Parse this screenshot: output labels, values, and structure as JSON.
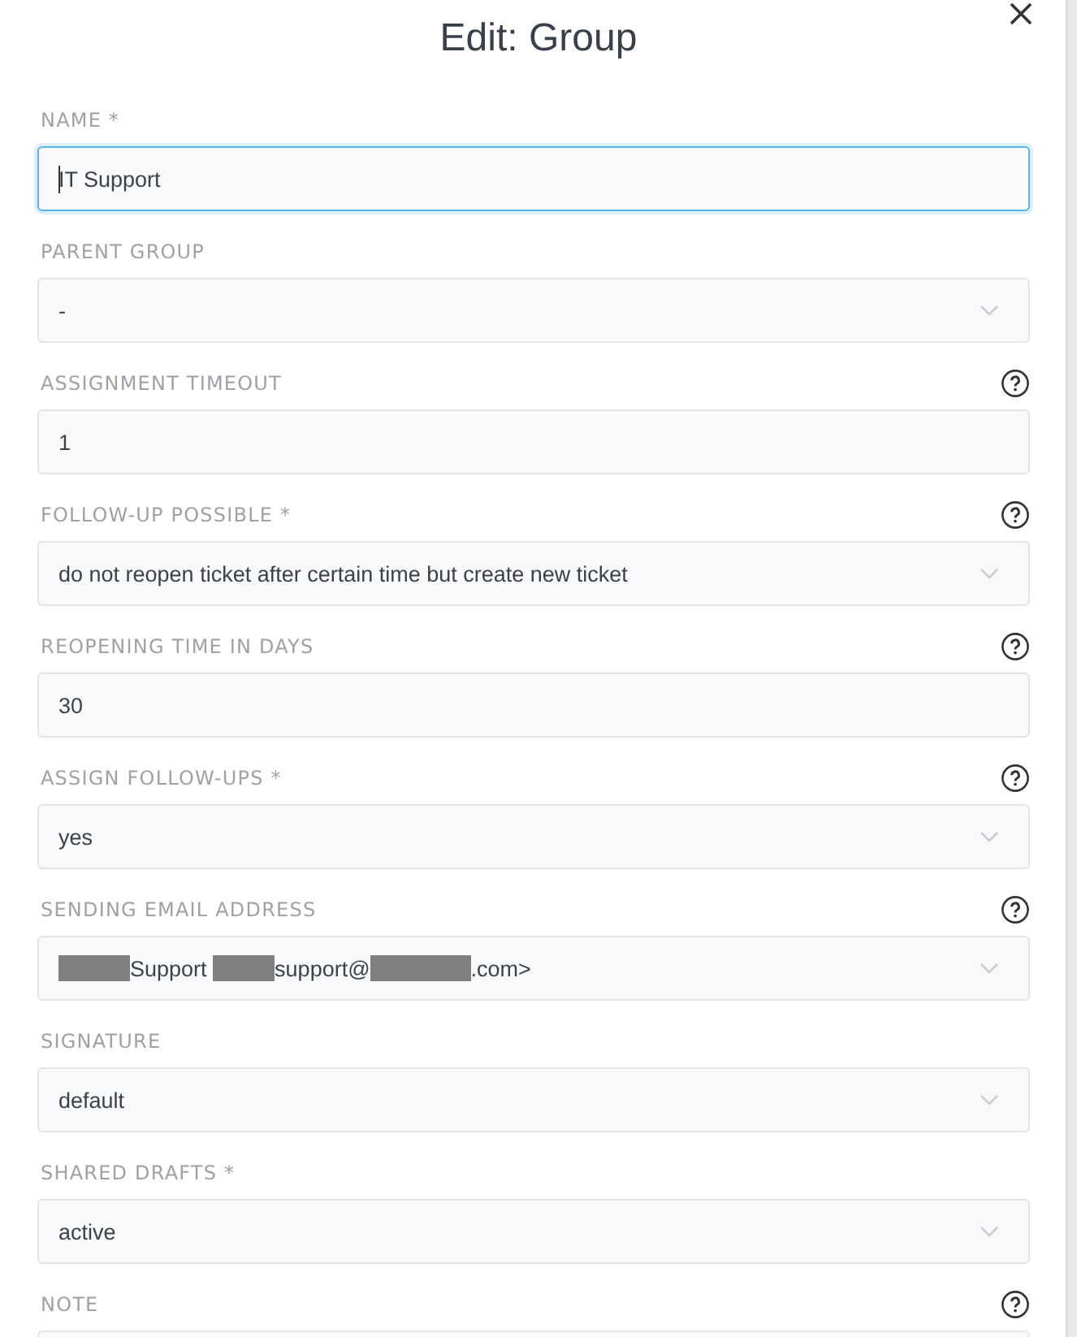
{
  "dialog": {
    "title": "Edit: Group"
  },
  "fields": [
    {
      "label": "NAME *",
      "kind": "input",
      "value": "IT Support",
      "focused": true,
      "help": false
    },
    {
      "label": "PARENT GROUP",
      "kind": "select",
      "value": "-",
      "focused": false,
      "help": false
    },
    {
      "label": "ASSIGNMENT TIMEOUT",
      "kind": "input",
      "value": "1",
      "focused": false,
      "help": true
    },
    {
      "label": "FOLLOW-UP POSSIBLE *",
      "kind": "select",
      "value": "do not reopen ticket after certain time but create new ticket",
      "focused": false,
      "help": true
    },
    {
      "label": "REOPENING TIME IN DAYS",
      "kind": "input",
      "value": "30",
      "focused": false,
      "help": true
    },
    {
      "label": "ASSIGN FOLLOW-UPS *",
      "kind": "select",
      "value": "yes",
      "focused": false,
      "help": true
    },
    {
      "label": "SENDING EMAIL ADDRESS",
      "kind": "select",
      "segments": [
        {
          "kind": "redacted"
        },
        {
          "kind": "text",
          "text": "Support "
        },
        {
          "kind": "redacted"
        },
        {
          "kind": "text",
          "text": "support@"
        },
        {
          "kind": "redacted"
        },
        {
          "kind": "text",
          "text": ".com>"
        }
      ],
      "focused": false,
      "help": true
    },
    {
      "label": "SIGNATURE",
      "kind": "select",
      "value": "default",
      "focused": false,
      "help": false
    },
    {
      "label": "SHARED DRAFTS *",
      "kind": "select",
      "value": "active",
      "focused": false,
      "help": false
    },
    {
      "label": "NOTE",
      "kind": "textarea",
      "focused": false,
      "help": true
    }
  ]
}
